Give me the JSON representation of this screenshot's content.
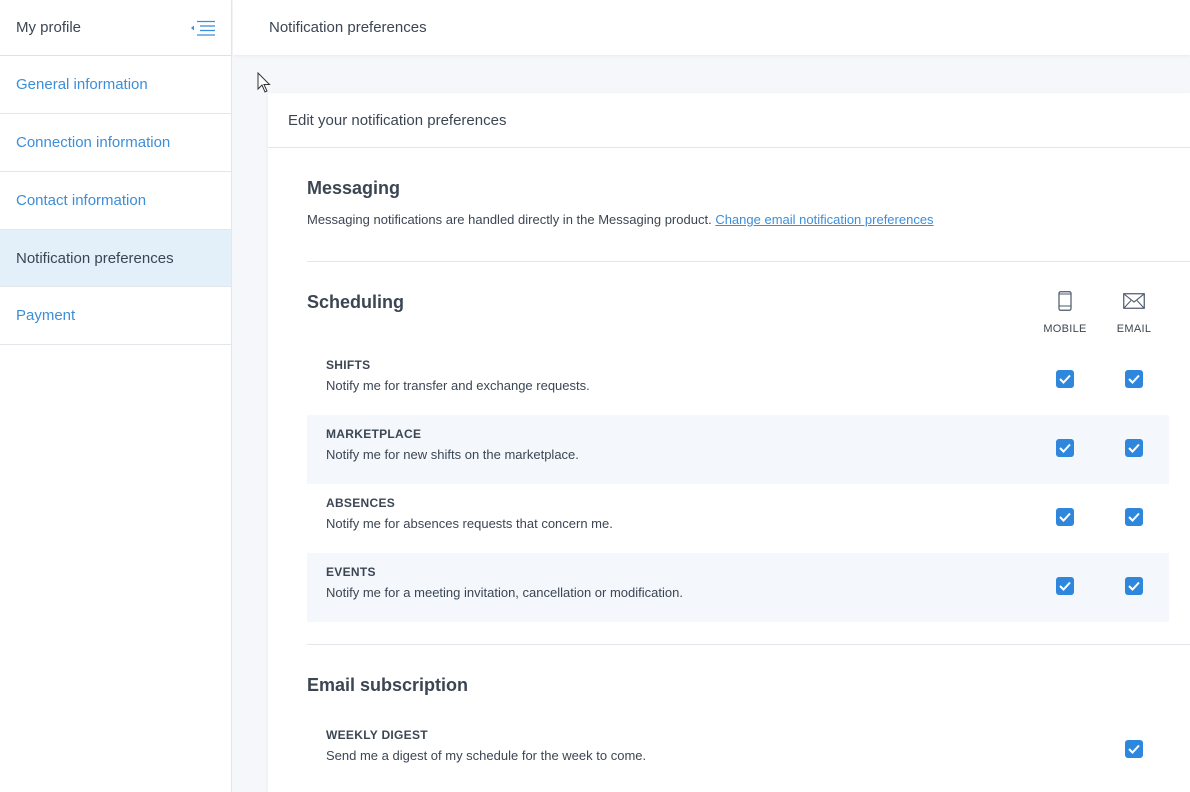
{
  "sidebar": {
    "title": "My profile",
    "items": [
      {
        "label": "General information"
      },
      {
        "label": "Connection information"
      },
      {
        "label": "Contact information"
      },
      {
        "label": "Notification preferences"
      },
      {
        "label": "Payment"
      }
    ]
  },
  "topbar": {
    "title": "Notification preferences"
  },
  "card": {
    "header": "Edit your notification preferences",
    "messaging": {
      "title": "Messaging",
      "text": "Messaging notifications are handled directly in the Messaging product.",
      "link": "Change email notification preferences"
    },
    "scheduling": {
      "title": "Scheduling",
      "col_mobile": "MOBILE",
      "col_email": "EMAIL",
      "rows": [
        {
          "name": "SHIFTS",
          "desc": "Notify me for transfer and exchange requests.",
          "mobile": true,
          "email": true
        },
        {
          "name": "MARKETPLACE",
          "desc": "Notify me for new shifts on the marketplace.",
          "mobile": true,
          "email": true
        },
        {
          "name": "ABSENCES",
          "desc": "Notify me for absences requests that concern me.",
          "mobile": true,
          "email": true
        },
        {
          "name": "EVENTS",
          "desc": "Notify me for a meeting invitation, cancellation or modification.",
          "mobile": true,
          "email": true
        }
      ]
    },
    "subscription": {
      "title": "Email subscription",
      "rows": [
        {
          "name": "WEEKLY DIGEST",
          "desc": "Send me a digest of my schedule for the week to come.",
          "email": true
        }
      ]
    }
  },
  "colors": {
    "accent": "#2f87dd",
    "link": "#3d8ed8",
    "active_bg": "#e3eff9"
  }
}
